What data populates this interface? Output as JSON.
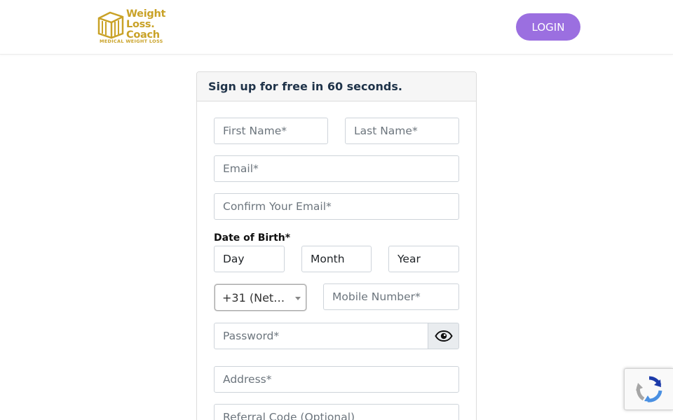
{
  "header": {
    "logo": {
      "line1": "Weight",
      "line2": "Loss.",
      "line3": "Coach",
      "tagline": "MEDICAL WEIGHT LOSS"
    },
    "login_label": "LOGIN"
  },
  "signup": {
    "title": "Sign up for free in 60 seconds.",
    "first_name_placeholder": "First Name*",
    "last_name_placeholder": "Last Name*",
    "email_placeholder": "Email*",
    "confirm_email_placeholder": "Confirm Your Email*",
    "dob_label": "Date of Birth*",
    "dob_day": "Day",
    "dob_month": "Month",
    "dob_year": "Year",
    "country_code": "+31 (Net…",
    "mobile_placeholder": "Mobile Number*",
    "password_placeholder": "Password*",
    "address_placeholder": "Address*",
    "referral_placeholder": "Referral Code (Optional)"
  },
  "colors": {
    "brand_gold": "#c9a227",
    "accent_purple": "#9b6fe0",
    "title_navy": "#1f3349"
  },
  "icons": {
    "password_toggle": "eye-icon",
    "captcha": "recaptcha-icon"
  }
}
